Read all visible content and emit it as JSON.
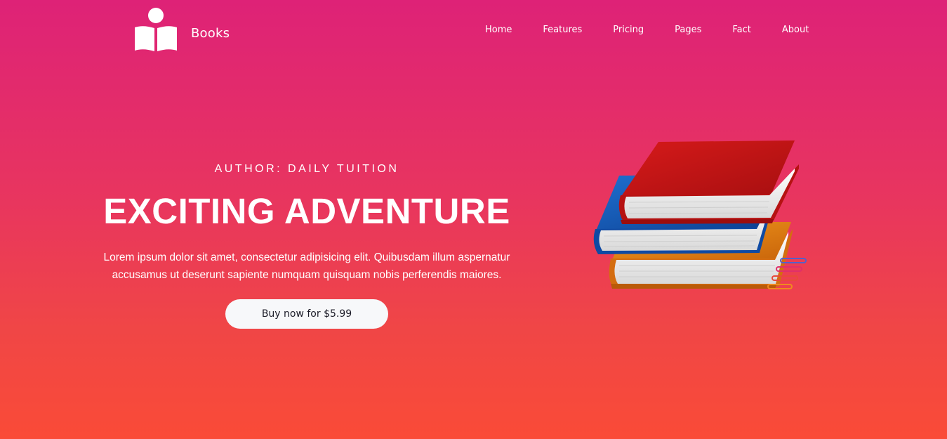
{
  "brand": {
    "name": "Books",
    "icon": "reading-person-icon"
  },
  "nav": {
    "items": [
      {
        "label": "Home"
      },
      {
        "label": "Features"
      },
      {
        "label": "Pricing"
      },
      {
        "label": "Pages"
      },
      {
        "label": "Fact"
      },
      {
        "label": "About"
      }
    ]
  },
  "hero": {
    "author": "AUTHOR: DAILY TUITION",
    "title": "EXCITING ADVENTURE",
    "description": "Lorem ipsum dolor sit amet, consectetur adipisicing elit. Quibusdam illum aspernatur accusamus ut deserunt sapiente numquam quisquam nobis perferendis maiores.",
    "button_label": "Buy now for $5.99",
    "image": "stack-of-books-illustration"
  },
  "colors": {
    "gradient_top": "#de2277",
    "gradient_bottom": "#fa4b37",
    "button_bg": "#f7f8fa",
    "button_text": "#1c1c28"
  }
}
